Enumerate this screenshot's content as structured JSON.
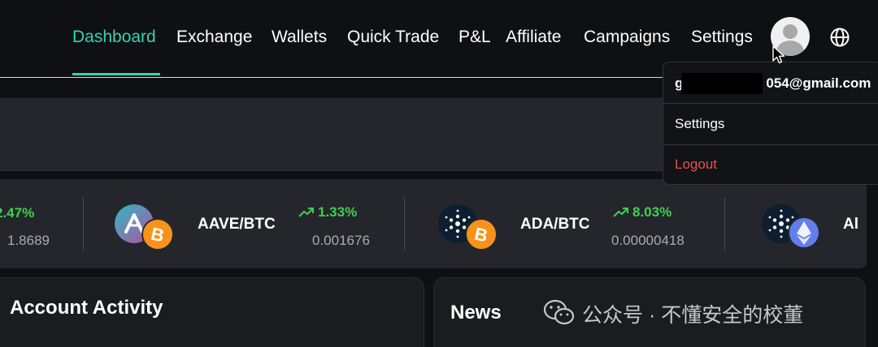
{
  "nav": {
    "items": [
      "Dashboard",
      "Exchange",
      "Wallets",
      "Quick Trade",
      "P&L",
      "Affiliate",
      "Campaigns",
      "Settings"
    ],
    "active": "Dashboard"
  },
  "user_menu": {
    "email": "g054@gmail.com",
    "email_prefix": "g",
    "email_suffix": "054@gmail.com",
    "settings_label": "Settings",
    "logout_label": "Logout"
  },
  "ticker": {
    "items": [
      {
        "pair": "",
        "change": "2.47%",
        "price": "1.8689"
      },
      {
        "pair": "AAVE/BTC",
        "change": "1.33%",
        "price": "0.001676"
      },
      {
        "pair": "ADA/BTC",
        "change": "8.03%",
        "price": "0.00000418"
      },
      {
        "pair": "Al",
        "change": "",
        "price": ""
      }
    ]
  },
  "panels": {
    "account_activity_title": "Account Activity",
    "news_title": "News"
  },
  "watermark": {
    "text": "公众号 · 不懂安全的校董"
  },
  "colors": {
    "accent": "#35d3b2",
    "positive": "#3fcf54",
    "logout": "#e5534b",
    "background": "#0f1013",
    "card": "#25262b"
  },
  "icons": [
    "user-avatar-icon",
    "globe-icon",
    "trend-up-icon",
    "aave-coin-icon",
    "btc-coin-icon",
    "ada-coin-icon",
    "eth-coin-icon",
    "wechat-icon",
    "mouse-cursor-icon"
  ]
}
